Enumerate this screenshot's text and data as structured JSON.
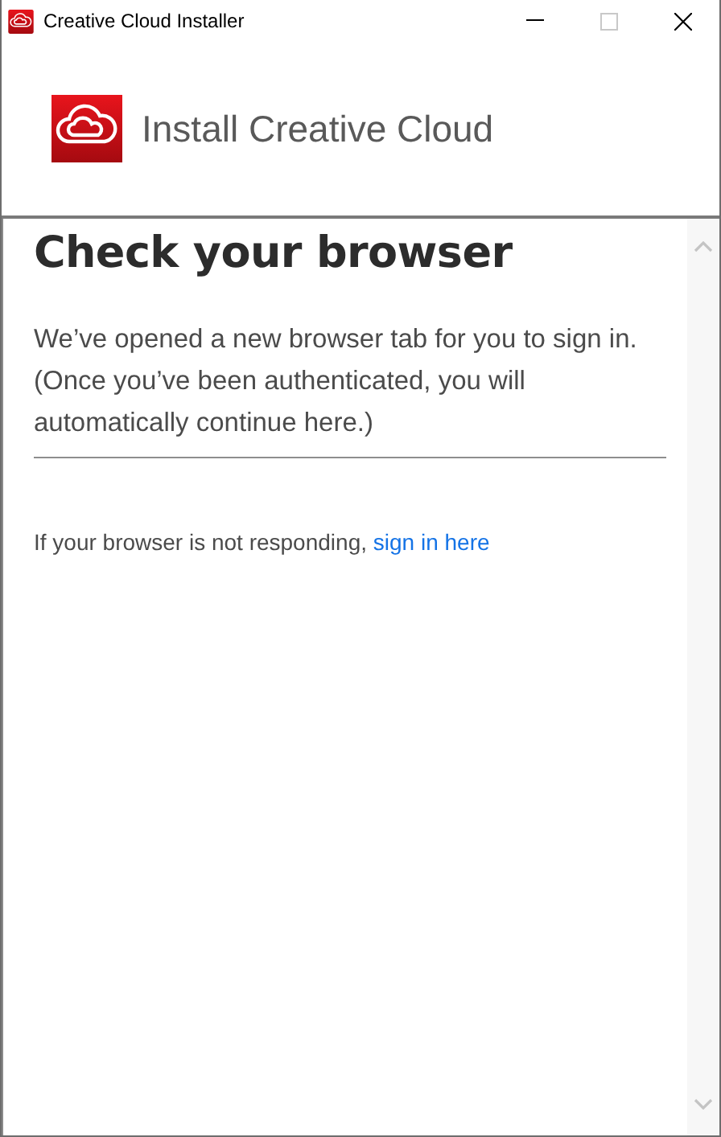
{
  "window": {
    "title": "Creative Cloud Installer"
  },
  "header": {
    "title": "Install Creative Cloud"
  },
  "content": {
    "heading": "Check your browser",
    "message": "We’ve opened a new browser tab for you to sign in. (Once you’ve been authenticated, you will automatically continue here.)",
    "hint": {
      "text": "If your browser is not responding, ",
      "link": "sign in here"
    }
  }
}
